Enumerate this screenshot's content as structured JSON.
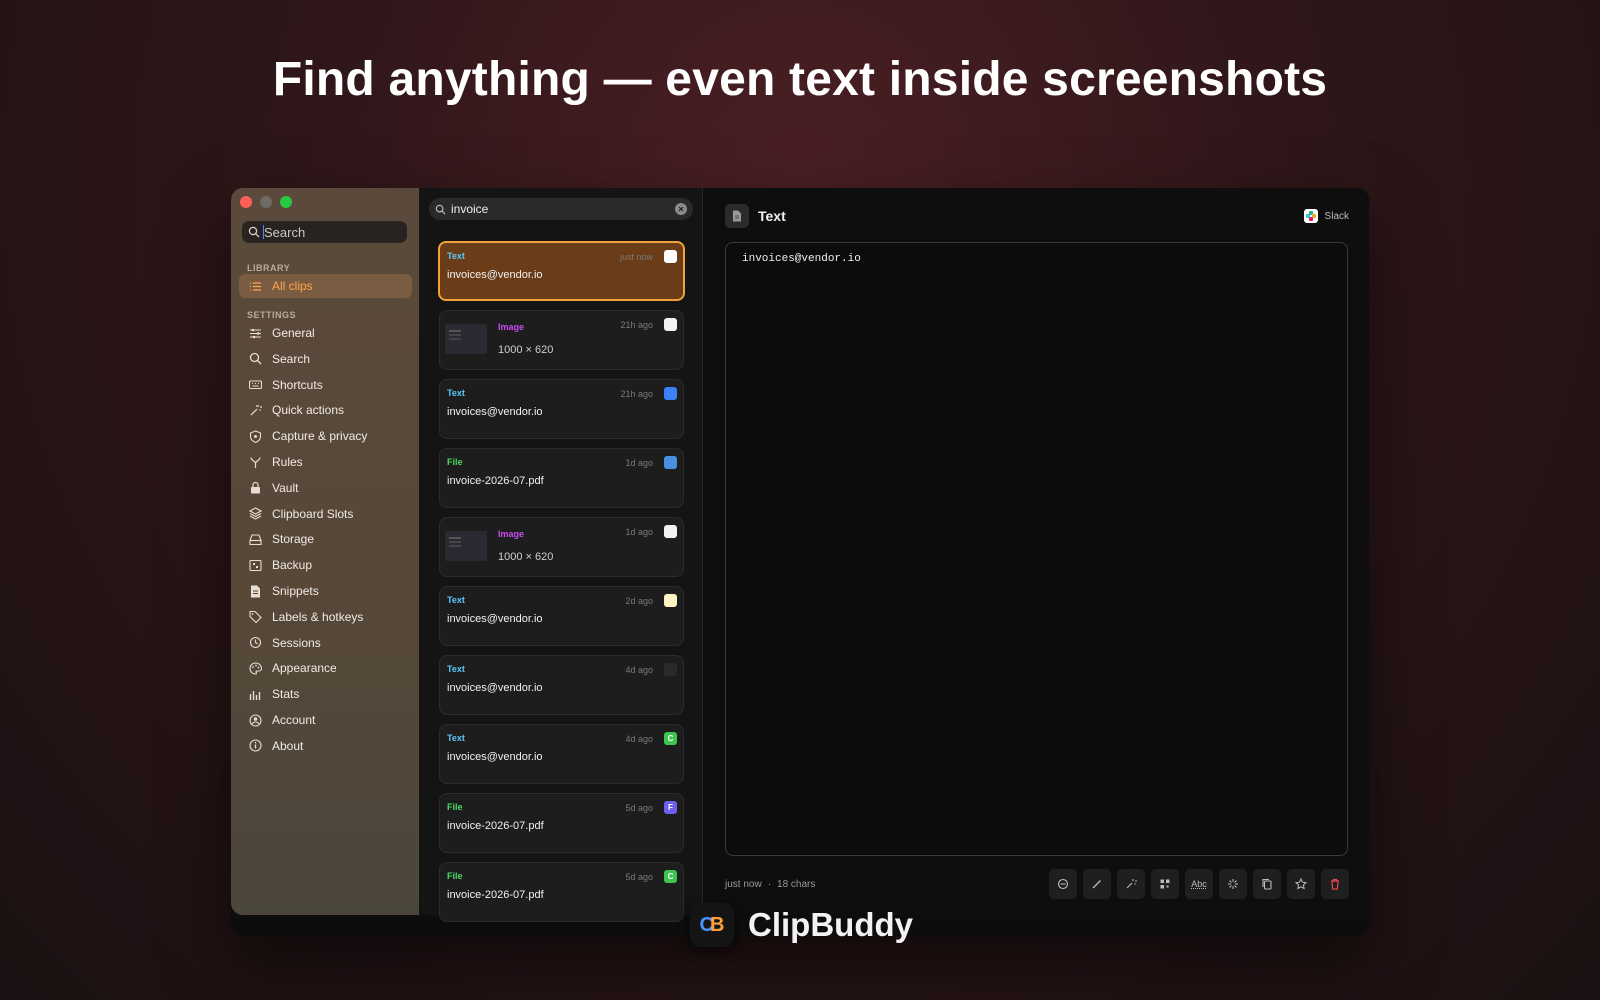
{
  "headline": "Find anything — even text inside screenshots",
  "sidebar": {
    "search_placeholder": "Search",
    "library_label": "LIBRARY",
    "settings_label": "SETTINGS",
    "library_items": [
      {
        "label": "All clips",
        "icon": "list-icon"
      }
    ],
    "settings_items": [
      {
        "label": "General",
        "icon": "sliders-icon"
      },
      {
        "label": "Search",
        "icon": "search-icon"
      },
      {
        "label": "Shortcuts",
        "icon": "keyboard-icon"
      },
      {
        "label": "Quick actions",
        "icon": "magic-wand-icon"
      },
      {
        "label": "Capture & privacy",
        "icon": "shield-icon"
      },
      {
        "label": "Rules",
        "icon": "fork-icon"
      },
      {
        "label": "Vault",
        "icon": "lock-icon"
      },
      {
        "label": "Clipboard Slots",
        "icon": "layers-icon"
      },
      {
        "label": "Storage",
        "icon": "drive-icon"
      },
      {
        "label": "Backup",
        "icon": "archive-icon"
      },
      {
        "label": "Snippets",
        "icon": "document-icon"
      },
      {
        "label": "Labels & hotkeys",
        "icon": "tag-icon"
      },
      {
        "label": "Sessions",
        "icon": "history-icon"
      },
      {
        "label": "Appearance",
        "icon": "palette-icon"
      },
      {
        "label": "Stats",
        "icon": "bar-chart-icon"
      },
      {
        "label": "Account",
        "icon": "user-circle-icon"
      },
      {
        "label": "About",
        "icon": "info-icon"
      }
    ]
  },
  "list": {
    "search_value": "invoice",
    "clips": [
      {
        "kind": "Text",
        "time": "just now",
        "body": "invoices@vendor.io",
        "app_icon": "slack-icon",
        "badge_color": "#ffffff",
        "badge_text": "",
        "selected": true
      },
      {
        "kind": "Image",
        "time": "21h ago",
        "body": "1000 × 620",
        "app_icon": "camera-icon",
        "badge_color": "#f2f2f2",
        "badge_text": "",
        "selected": false
      },
      {
        "kind": "Text",
        "time": "21h ago",
        "body": "invoices@vendor.io",
        "app_icon": "mail-icon",
        "badge_color": "#3b82f6",
        "badge_text": "",
        "selected": false
      },
      {
        "kind": "File",
        "time": "1d ago",
        "body": "invoice-2026-07.pdf",
        "app_icon": "finder-icon",
        "badge_color": "#4a90e2",
        "badge_text": "",
        "selected": false
      },
      {
        "kind": "Image",
        "time": "1d ago",
        "body": "1000 × 620",
        "app_icon": "camera-icon",
        "badge_color": "#f2f2f2",
        "badge_text": "",
        "selected": false
      },
      {
        "kind": "Text",
        "time": "2d ago",
        "body": "invoices@vendor.io",
        "app_icon": "notes-icon",
        "badge_color": "#fff3c4",
        "badge_text": "",
        "selected": false
      },
      {
        "kind": "Text",
        "time": "4d ago",
        "body": "invoices@vendor.io",
        "app_icon": "terminal-icon",
        "badge_color": "#2a2a2a",
        "badge_text": "",
        "selected": false
      },
      {
        "kind": "Text",
        "time": "4d ago",
        "body": "invoices@vendor.io",
        "app_icon": "letter-c-icon",
        "badge_color": "#3ec44f",
        "badge_text": "C",
        "selected": false
      },
      {
        "kind": "File",
        "time": "5d ago",
        "body": "invoice-2026-07.pdf",
        "app_icon": "letter-f-icon",
        "badge_color": "#6f5ff0",
        "badge_text": "F",
        "selected": false
      },
      {
        "kind": "File",
        "time": "5d ago",
        "body": "invoice-2026-07.pdf",
        "app_icon": "letter-c-icon",
        "badge_color": "#3ec44f",
        "badge_text": "C",
        "selected": false
      }
    ]
  },
  "detail": {
    "title": "Text",
    "source_app": "Slack",
    "content": "invoices@vendor.io",
    "meta_time": "just now",
    "meta_sep": "·",
    "meta_chars": "18 chars",
    "toolbar": [
      {
        "name": "minus-circle-icon",
        "label": ""
      },
      {
        "name": "pencil-icon",
        "label": ""
      },
      {
        "name": "magic-wand-icon",
        "label": ""
      },
      {
        "name": "qr-code-icon",
        "label": ""
      },
      {
        "name": "spellcheck-button",
        "label": "Abc"
      },
      {
        "name": "sparkle-icon",
        "label": ""
      },
      {
        "name": "copy-icon",
        "label": ""
      },
      {
        "name": "star-icon",
        "label": ""
      },
      {
        "name": "trash-icon",
        "label": ""
      }
    ],
    "delete_color": "#e5484d"
  },
  "brand": {
    "name": "ClipBuddy",
    "logo_text_c": "C",
    "logo_text_b": "B"
  },
  "colors": {
    "accent": "#ffa64a",
    "text_kind": "#5ac8fa",
    "image_kind": "#c94cf0",
    "file_kind": "#4cd964"
  }
}
